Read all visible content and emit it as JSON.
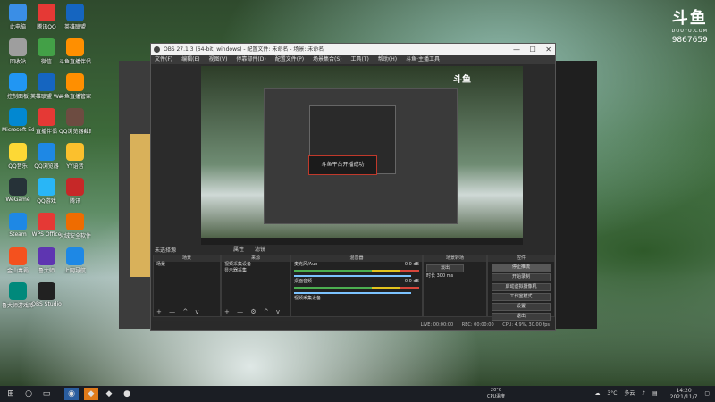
{
  "desktop": {
    "icons": [
      {
        "label": "此电脑",
        "color": "#3a8ee6"
      },
      {
        "label": "腾讯QQ",
        "color": "#e53935"
      },
      {
        "label": "英雄联盟",
        "color": "#1565c0"
      },
      {
        "label": "回收站",
        "color": "#9e9e9e"
      },
      {
        "label": "微信",
        "color": "#43a047"
      },
      {
        "label": "斗鱼直播伴侣",
        "color": "#ff8f00"
      },
      {
        "label": "控制面板",
        "color": "#2196f3"
      },
      {
        "label": "英雄联盟 WeGame版",
        "color": "#1565c0"
      },
      {
        "label": "斗鱼直播管家",
        "color": "#ff8f00"
      },
      {
        "label": "Microsoft Edge",
        "color": "#0288d1"
      },
      {
        "label": "直播伴侣",
        "color": "#e53935"
      },
      {
        "label": "QQ浏览器截图20211105",
        "color": "#6d4c41"
      },
      {
        "label": "QQ音乐",
        "color": "#fdd835"
      },
      {
        "label": "QQ浏览器",
        "color": "#1e88e5"
      },
      {
        "label": "YY语音",
        "color": "#fbc02d"
      },
      {
        "label": "WeGame",
        "color": "#263238"
      },
      {
        "label": "QQ游戏",
        "color": "#29b6f6"
      },
      {
        "label": "腾讯",
        "color": "#c62828"
      },
      {
        "label": "Steam",
        "color": "#1e88e5"
      },
      {
        "label": "WPS Office",
        "color": "#e53935"
      },
      {
        "label": "火绒安全软件",
        "color": "#ef6c00"
      },
      {
        "label": "金山毒霸",
        "color": "#f4511e"
      },
      {
        "label": "鲁大师",
        "color": "#5e35b1"
      },
      {
        "label": "上网导航",
        "color": "#1e88e5"
      },
      {
        "label": "鲁大师游戏库",
        "color": "#00897b"
      },
      {
        "label": "OBS Studio",
        "color": "#212121"
      }
    ]
  },
  "douyu": {
    "logo": "斗鱼",
    "sub": "DOUYU.COM",
    "room": "9867659"
  },
  "obs": {
    "title": "OBS 27.1.3 (64-bit, windows) - 配置文件: 未命名 - 场景: 未命名",
    "controls": {
      "minimize": "—",
      "maximize": "☐",
      "close": "✕"
    },
    "menu": [
      "文件(F)",
      "编辑(E)",
      "视图(V)",
      "停靠部件(D)",
      "配置文件(P)",
      "场景集合(S)",
      "工具(T)",
      "帮助(H)",
      "斗鱼·主播工具"
    ],
    "preview_toast": "斗鱼平台开播成功",
    "preview_logo": "斗鱼",
    "scene_status": "未选择源",
    "studio_buttons": [
      "属性",
      "滤镜"
    ],
    "docks": {
      "scenes": {
        "header": "场景",
        "items": [
          "场景"
        ],
        "footer": "+ — ^ v"
      },
      "sources": {
        "header": "来源",
        "items": [
          "视频采集设备",
          "显示器采集"
        ],
        "footer": "+ — ⚙ ^ v"
      },
      "mixer": {
        "header": "混音器",
        "channels": [
          {
            "name": "麦克风/Aux",
            "db": "0.0 dB"
          },
          {
            "name": "桌面音频",
            "db": "0.0 dB"
          },
          {
            "name": "视频采集设备",
            "db": ""
          }
        ]
      },
      "transitions": {
        "header": "场景转场",
        "type": "淡出",
        "duration_label": "时长",
        "duration": "300 ms"
      },
      "controls": {
        "header": "控件",
        "buttons": [
          "停止推流",
          "开始录制",
          "启动虚拟摄像机",
          "工作室模式",
          "设置",
          "退出"
        ]
      }
    },
    "status": {
      "live": "LIVE: 00:00:00",
      "rec": "REC: 00:00:00",
      "cpu": "CPU: 4.9%, 30.00 fps"
    }
  },
  "taskbar": {
    "start": "⊞",
    "weather_temp": "20°C",
    "weather_label": "CPU温度",
    "temp2": "3°C",
    "tray": "多云",
    "time": "14:20",
    "date": "2021/11/7"
  }
}
